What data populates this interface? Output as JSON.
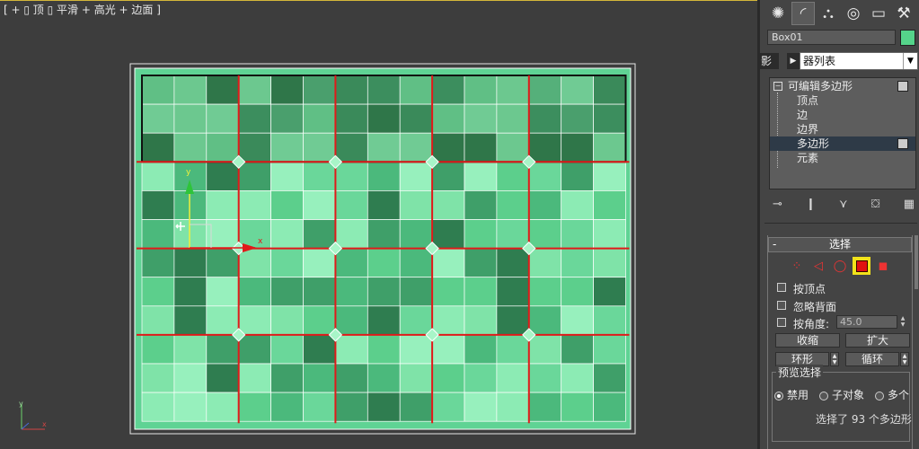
{
  "viewport": {
    "label": "[ + ▯ 顶 ▯ 平滑 + 高光 + 边面 ]",
    "gizmo_x_label": "x",
    "gizmo_y_label": "y",
    "axis_x_label": "x",
    "axis_y_label": "y",
    "colors": {
      "background": "#3d3d3d",
      "selection_edge": "#e01a1a",
      "wire": "#ffffff",
      "accent_border": "#d4b63a"
    }
  },
  "command_panel": {
    "tabs": [
      {
        "icon": "sun-gear-icon",
        "glyph": "✺"
      },
      {
        "icon": "curve-modify-icon",
        "glyph": "◜"
      },
      {
        "icon": "hierarchy-icon",
        "glyph": "⛬"
      },
      {
        "icon": "motion-icon",
        "glyph": "◎"
      },
      {
        "icon": "display-monitor-icon",
        "glyph": "▭"
      },
      {
        "icon": "utilities-hammer-icon",
        "glyph": "⚒"
      }
    ],
    "object_name": "Box01",
    "object_color": "#55d48a",
    "modifier_list_trunc": "影",
    "modifier_list_label": "器列表",
    "stack": {
      "root": "可编辑多边形",
      "items": [
        "顶点",
        "边",
        "边界",
        "多边形",
        "元素"
      ],
      "selected": "多边形"
    },
    "selection_rollout": {
      "title": "选择",
      "collapse_symbol": "-",
      "by_vertex": "按顶点",
      "ignore_backfacing": "忽略背面",
      "by_angle": "按角度:",
      "angle_value": "45.0",
      "shrink": "收缩",
      "grow": "扩大",
      "ring": "环形",
      "loop": "循环",
      "preview_group": "预览选择",
      "preview_options": [
        "禁用",
        "子对象",
        "多个"
      ],
      "preview_selected": "禁用",
      "status": "选择了 93 个多边形"
    }
  }
}
